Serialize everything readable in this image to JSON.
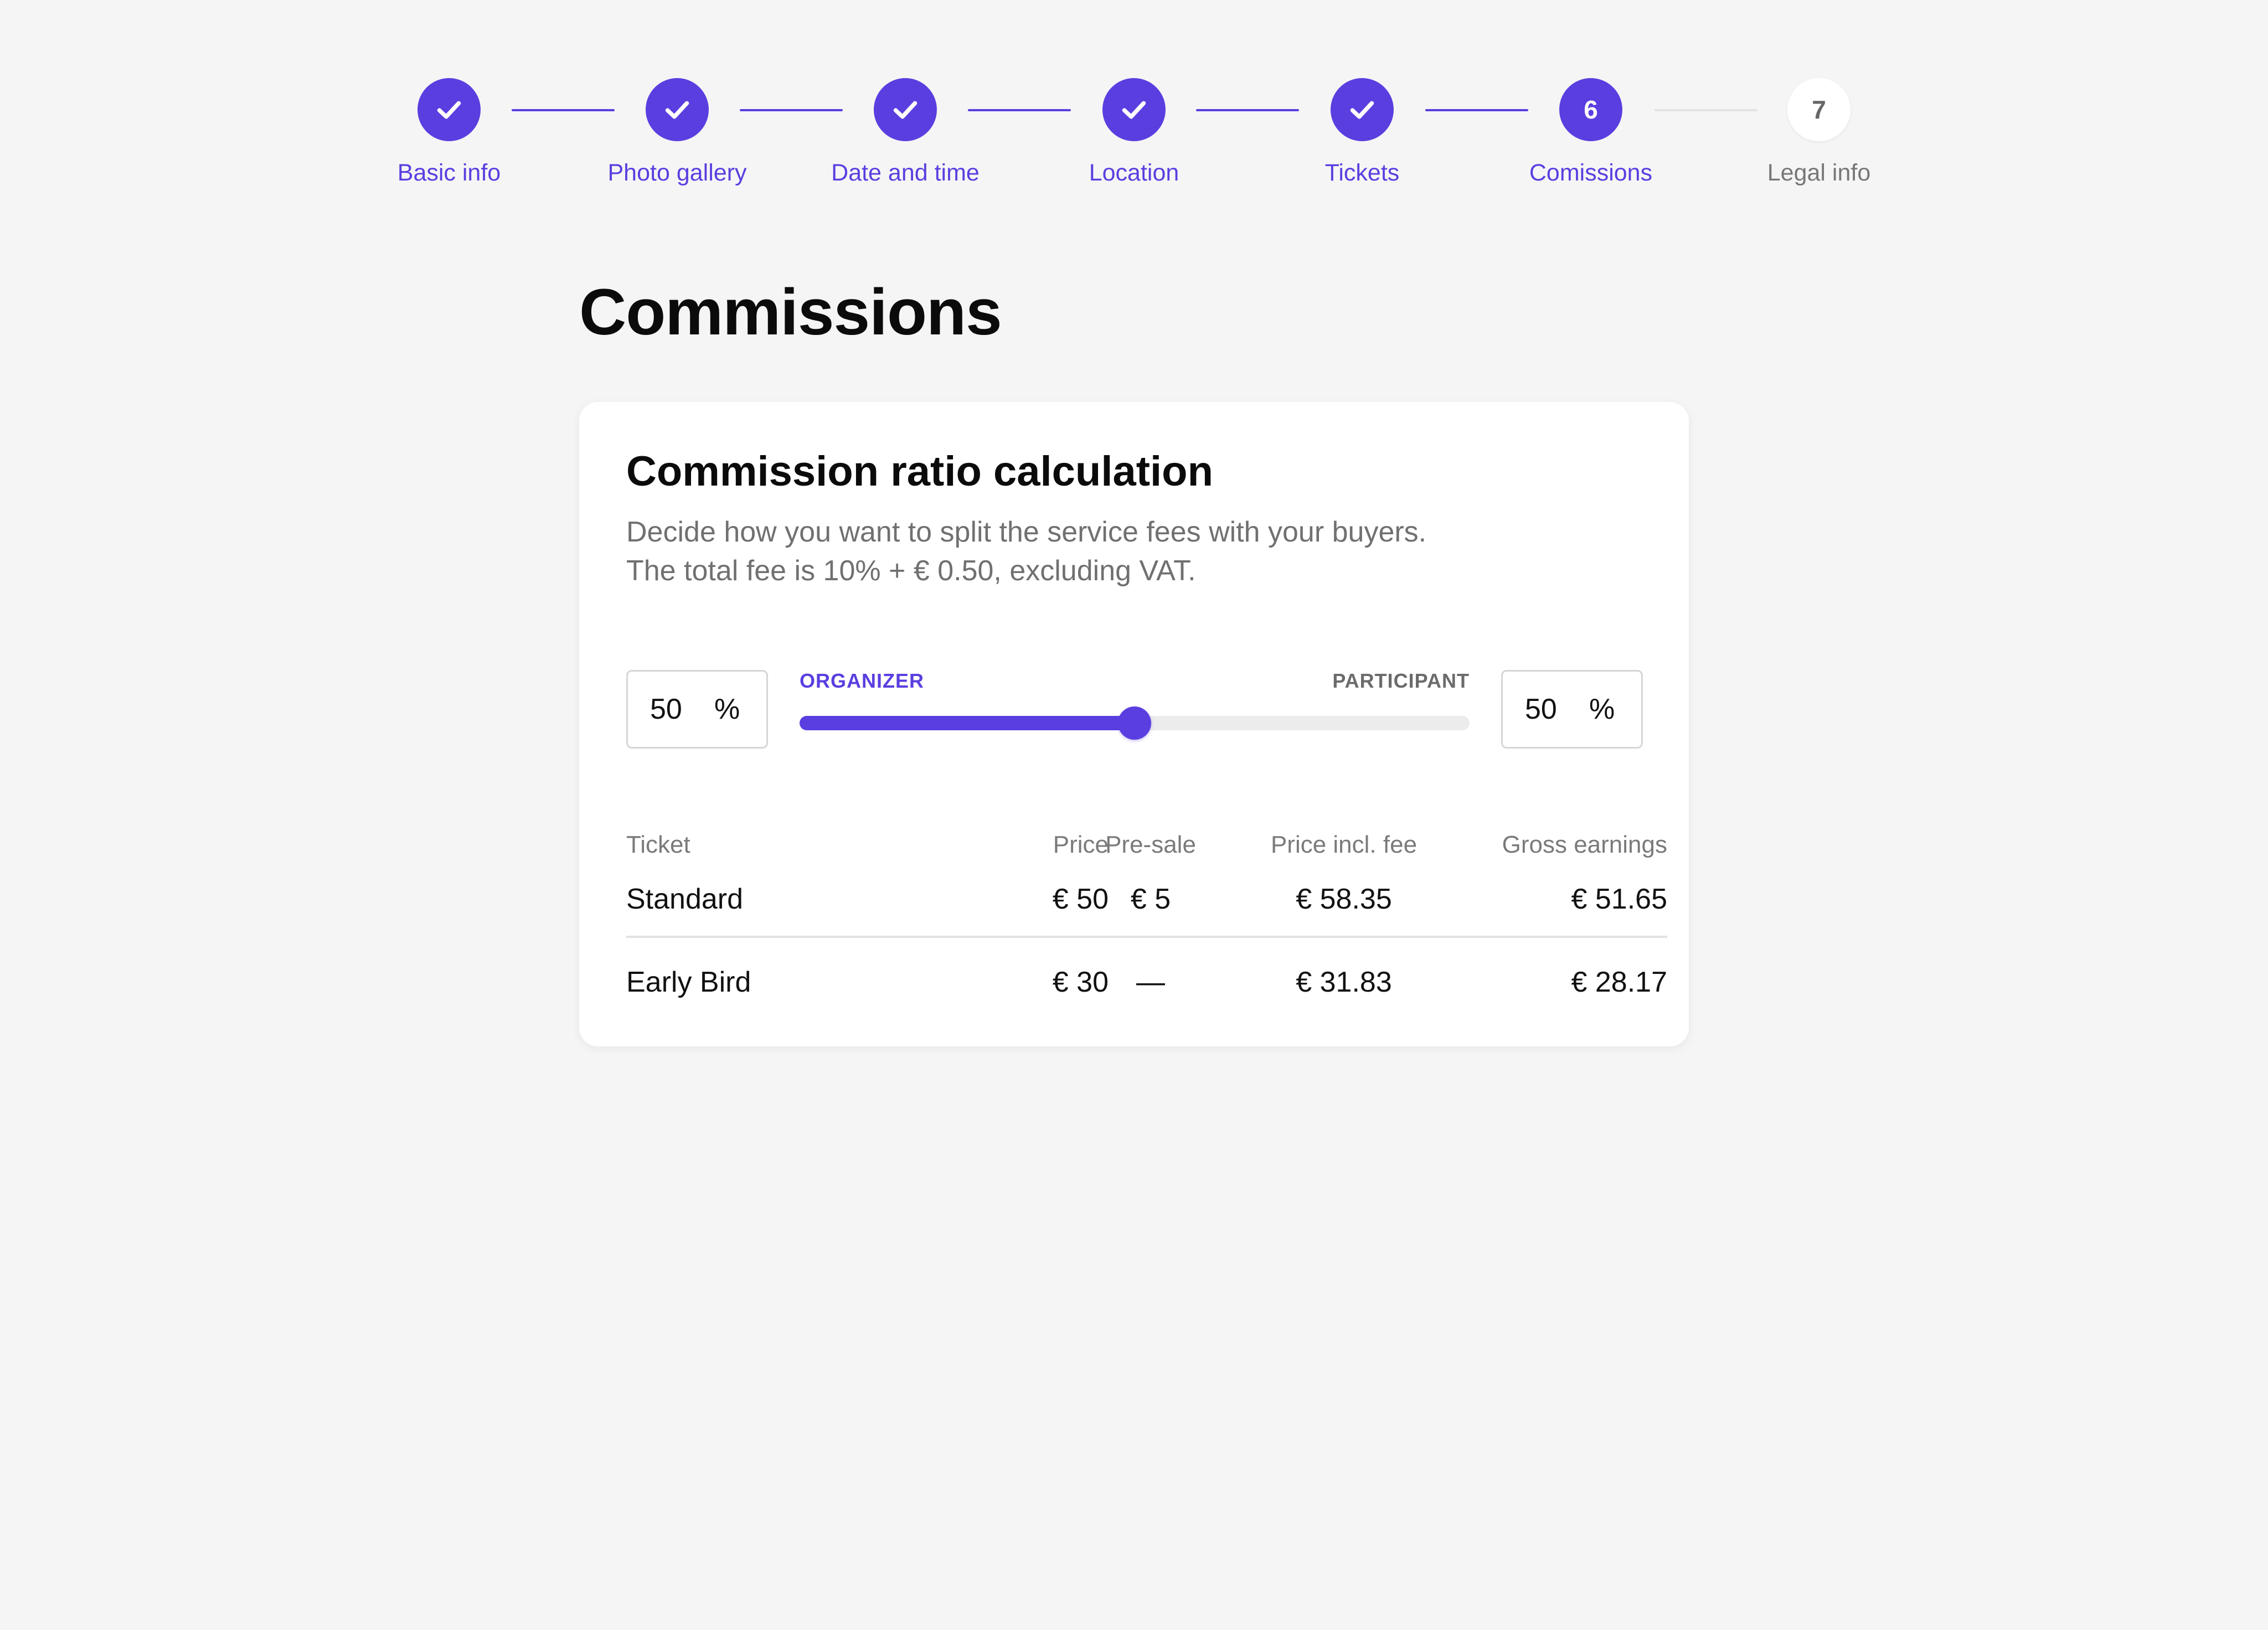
{
  "stepper": {
    "steps": [
      {
        "label": "Basic info",
        "state": "done",
        "number": "1"
      },
      {
        "label": "Photo gallery",
        "state": "done",
        "number": "2"
      },
      {
        "label": "Date and time",
        "state": "done",
        "number": "3"
      },
      {
        "label": "Location",
        "state": "done",
        "number": "4"
      },
      {
        "label": "Tickets",
        "state": "done",
        "number": "5"
      },
      {
        "label": "Comissions",
        "state": "current",
        "number": "6"
      },
      {
        "label": "Legal info",
        "state": "upcoming",
        "number": "7"
      }
    ],
    "done_icon": "checkmark-icon",
    "accent_color": "#5b3ee0"
  },
  "page": {
    "title": "Commissions"
  },
  "card": {
    "title": "Commission ratio calculation",
    "description_line1": "Decide how you want to split the service fees with your buyers.",
    "description_line2": "The total fee is 10% + € 0.50, excluding VAT."
  },
  "split": {
    "organizer_label": "ORGANIZER",
    "participant_label": "PARTICIPANT",
    "organizer_value": "50",
    "participant_value": "50",
    "unit": "%",
    "slider_fraction": 0.5
  },
  "table": {
    "headers": {
      "ticket": "Ticket",
      "price": "Price",
      "presale": "Pre-sale",
      "price_incl_fee": "Price incl. fee",
      "gross_earnings": "Gross earnings"
    },
    "rows": [
      {
        "ticket": "Standard",
        "price": "€ 50",
        "presale": "€ 5",
        "price_incl_fee": "€ 58.35",
        "gross_earnings": "€ 51.65"
      },
      {
        "ticket": "Early Bird",
        "price": "€ 30",
        "presale": "—",
        "price_incl_fee": "€ 31.83",
        "gross_earnings": "€ 28.17"
      }
    ]
  }
}
